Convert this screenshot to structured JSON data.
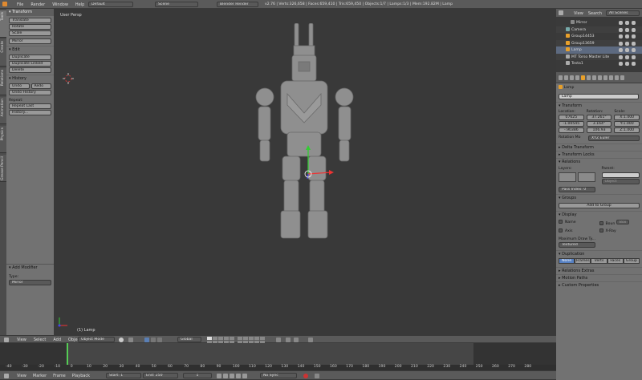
{
  "topbar": {
    "menus": [
      "File",
      "Render",
      "Window",
      "Help"
    ],
    "layout": "Default",
    "scene": "Scene",
    "engine": "Blender Render",
    "stats": "v2.76 | Verts:326,658 | Faces:659,410 | Tris:659,450 | Objects:1/7 | Lamps:1/3 | Mem:192.82M | Lamp"
  },
  "left_tabs": [
    "Tools",
    "Create",
    "Relations",
    "Animation",
    "Physics",
    "Grease Pencil"
  ],
  "toolshelf": {
    "transform_title": "Transform",
    "transform_buttons": [
      "Translate",
      "Rotate",
      "Scale"
    ],
    "mirror": "Mirror",
    "edit_title": "Edit",
    "edit_buttons": [
      "Duplicate",
      "Duplicate Linked",
      "Delete"
    ],
    "history_title": "History",
    "undo": "Undo",
    "redo": "Redo",
    "undo_history": "Undo History",
    "repeat_label": "Repeat:",
    "repeat_last": "Repeat Last",
    "history_btn": "History..."
  },
  "operator": {
    "title": "Add Modifier",
    "type_label": "Type:",
    "type_value": "Mirror"
  },
  "viewport": {
    "label": "User Persp",
    "object_label": "(1) Lamp"
  },
  "viewport_header": {
    "menus": [
      "View",
      "Select",
      "Add",
      "Object"
    ],
    "mode": "Object Mode",
    "orientation": "Global"
  },
  "outliner": {
    "menus": [
      "View",
      "Search"
    ],
    "filter": "All Scenes",
    "items": [
      "Mirror",
      "Camera",
      "Group14453",
      "Group13659",
      "Lamp",
      "MT Torso Master Lite",
      "Testa1"
    ]
  },
  "props": {
    "breadcrumb": "Lamp",
    "name": "Lamp",
    "transform_title": "Transform",
    "location_label": "Location:",
    "rotation_label": "Rotation:",
    "scale_label": "Scale:",
    "location": [
      "07625",
      "-1.00545",
      "-.90386"
    ],
    "rotation": [
      "37.261°",
      "3.164°",
      "106.93"
    ],
    "scale": [
      "X:1.000",
      "Y:1.000",
      "Z:1.000"
    ],
    "rotmode_label": "Rotation Mo",
    "rotmode": "XYZ Euler",
    "delta_title": "Delta Transform",
    "locks_title": "Transform Locks",
    "relations_title": "Relations",
    "layers_label": "Layers:",
    "parent_label": "Parent:",
    "parent_type": "Object",
    "pass_index": "Pass Index:",
    "pass_value": "0",
    "groups_title": "Groups",
    "add_group": "Add to Group",
    "display_title": "Display",
    "name_cb": "Name",
    "bounds_cb": "Boun",
    "box": "Box",
    "axis_cb": "Axis",
    "xray_cb": "X-Ray",
    "maxdraw_label": "Maximum Draw Ty...",
    "maxdraw": "Textured",
    "dup_title": "Duplication",
    "dup_options": [
      "None",
      "Frames",
      "Verts",
      "Faces",
      "Group"
    ],
    "extras_title": "Relations Extras",
    "motion_title": "Motion Paths",
    "custom_title": "Custom Properties"
  },
  "timeline": {
    "menus": [
      "View",
      "Marker",
      "Frame",
      "Playback"
    ],
    "start_label": "Start:",
    "start": "1",
    "end_label": "End:",
    "end": "250",
    "current": "1",
    "sync": "No Sync",
    "ticks": [
      "-40",
      "-30",
      "-20",
      "-10",
      "0",
      "10",
      "20",
      "30",
      "40",
      "50",
      "60",
      "70",
      "80",
      "90",
      "100",
      "110",
      "120",
      "130",
      "140",
      "150",
      "160",
      "170",
      "180",
      "190",
      "200",
      "210",
      "220",
      "230",
      "240",
      "250",
      "260",
      "270",
      "280"
    ]
  }
}
